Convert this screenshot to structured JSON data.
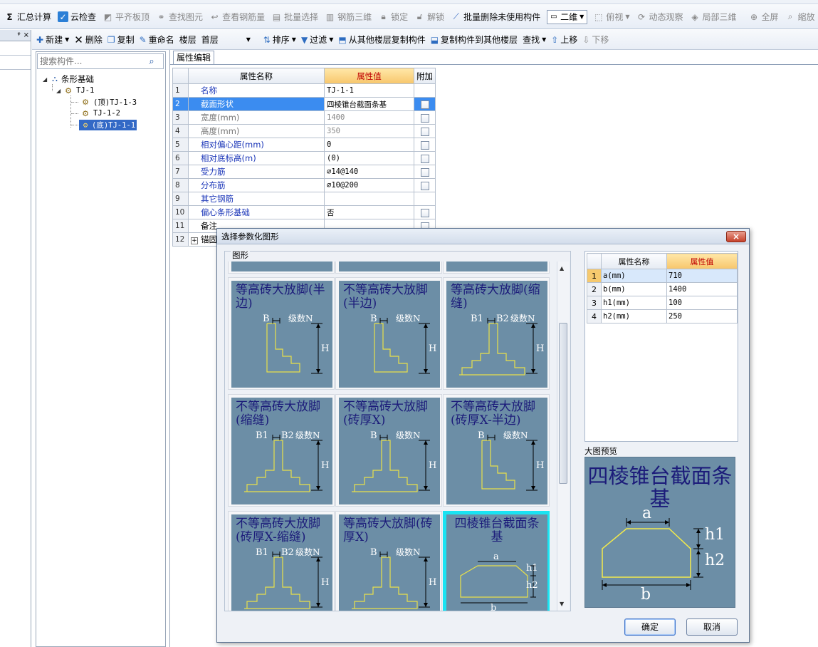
{
  "toolbar": {
    "items": [
      "汇总计算",
      "云检查",
      "平齐板顶",
      "查找图元",
      "查看钢筋量",
      "批量选择",
      "钢筋三维",
      "锁定",
      "解锁",
      "批量删除未使用构件"
    ],
    "view_combo": "二维",
    "items2": [
      "俯视",
      "动态观察",
      "局部三维",
      "全屏",
      "缩放"
    ]
  },
  "left_panel": {
    "pin": "ᵠ",
    "close": "×"
  },
  "toolbar2": {
    "new": "新建",
    "delete": "删除",
    "copy": "复制",
    "rename": "重命名",
    "floor_label": "楼层",
    "floor_value": "首层",
    "sort": "排序",
    "filter": "过滤",
    "copy_from_floor": "从其他楼层复制构件",
    "copy_to_floor": "复制构件到其他楼层",
    "find": "查找",
    "move_up": "上移",
    "move_down": "下移"
  },
  "tree": {
    "search_placeholder": "搜索构件...",
    "root": "条形基础",
    "group": "TJ-1",
    "children": [
      "(顶)TJ-1-3",
      "TJ-1-2",
      "(底)TJ-1-1"
    ]
  },
  "prop_panel": {
    "tab": "属性编辑",
    "headers": {
      "name": "属性名称",
      "value": "属性值",
      "extra": "附加"
    },
    "rows": [
      {
        "num": "1",
        "name": "名称",
        "value": "TJ-1-1",
        "check": false
      },
      {
        "num": "2",
        "name": "截面形状",
        "value": "四棱锥台截面条基",
        "check": true
      },
      {
        "num": "3",
        "name": "宽度(mm)",
        "value": "1400",
        "check": true
      },
      {
        "num": "4",
        "name": "高度(mm)",
        "value": "350",
        "check": true
      },
      {
        "num": "5",
        "name": "相对偏心距(mm)",
        "value": "0",
        "check": true
      },
      {
        "num": "6",
        "name": "相对底标高(m)",
        "value": "(0)",
        "check": true
      },
      {
        "num": "7",
        "name": "受力筋",
        "value": "⌀14@140",
        "check": true
      },
      {
        "num": "8",
        "name": "分布筋",
        "value": "⌀10@200",
        "check": true
      },
      {
        "num": "9",
        "name": "其它钢筋",
        "value": "",
        "check": false
      },
      {
        "num": "10",
        "name": "偏心条形基础",
        "value": "否",
        "check": true
      },
      {
        "num": "11",
        "name": "备注",
        "value": "",
        "check": true
      },
      {
        "num": "12",
        "name": "锚固",
        "value": "",
        "check": false
      }
    ]
  },
  "dialog": {
    "title": "选择参数化图形",
    "close": "×",
    "group_title": "图形",
    "shapes": [
      {
        "title": "等高砖大放脚(半边)",
        "labels": {
          "b": "B",
          "n": "级数N",
          "h": "H"
        }
      },
      {
        "title": "不等高砖大放脚(半边)",
        "labels": {
          "b": "B",
          "n": "级数N",
          "h": "H"
        }
      },
      {
        "title": "等高砖大放脚(缩缝)",
        "labels": {
          "b1": "B1",
          "b2": "B2",
          "n": "级数N",
          "h": "H"
        }
      },
      {
        "title": "不等高砖大放脚(缩缝)",
        "labels": {
          "b1": "B1",
          "b2": "B2",
          "n": "级数N",
          "h": "H"
        }
      },
      {
        "title": "不等高砖大放脚(砖厚X)",
        "labels": {
          "b": "B",
          "n": "级数N",
          "h": "H"
        }
      },
      {
        "title": "不等高砖大放脚(砖厚X-半边)",
        "labels": {
          "b": "B",
          "n": "级数N",
          "h": "H"
        }
      },
      {
        "title": "不等高砖大放脚(砖厚X-缩缝)",
        "labels": {
          "b1": "B1",
          "b2": "B2",
          "n": "级数N",
          "h": "H"
        }
      },
      {
        "title": "等高砖大放脚(砖厚X)",
        "labels": {
          "b": "B",
          "n": "级数N",
          "h": "H"
        }
      },
      {
        "title": "四棱锥台截面条基",
        "labels": {
          "a": "a",
          "h1": "h1",
          "h2": "h2",
          "b": "b"
        }
      }
    ],
    "params": {
      "headers": {
        "name": "属性名称",
        "value": "属性值"
      },
      "rows": [
        {
          "num": "1",
          "name": "a(mm)",
          "value": "710"
        },
        {
          "num": "2",
          "name": "b(mm)",
          "value": "1400"
        },
        {
          "num": "3",
          "name": "h1(mm)",
          "value": "100"
        },
        {
          "num": "4",
          "name": "h2(mm)",
          "value": "250"
        }
      ]
    },
    "preview_label": "大图预览",
    "preview": {
      "title": "四棱锥台截面条基",
      "a": "a",
      "h1": "h1",
      "h2": "h2",
      "b": "b"
    },
    "ok": "确定",
    "cancel": "取消"
  }
}
